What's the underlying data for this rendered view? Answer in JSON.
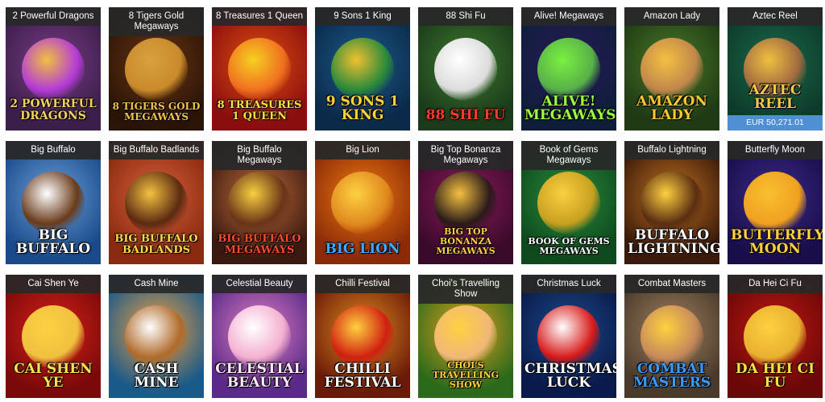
{
  "games": [
    {
      "title": "2 Powerful Dragons",
      "logo": "2 POWERFUL DRAGONS",
      "bg": "#3b1f4a",
      "bg2": "#7a3b86",
      "accent": "#f0c040",
      "fig": "#b43ad8",
      "logo_color": "#f4d060"
    },
    {
      "title": "8 Tigers Gold Megaways",
      "logo": "8 TIGERS GOLD MEGAWAYS",
      "bg": "#2a1408",
      "bg2": "#6a3510",
      "accent": "#d8a040",
      "fig": "#c98a2c",
      "logo_color": "#f2c24a"
    },
    {
      "title": "8 Treasures 1 Queen",
      "logo": "8 TREASURES 1 QUEEN",
      "bg": "#8a0e0e",
      "bg2": "#e05010",
      "accent": "#f6d020",
      "fig": "#f07020",
      "logo_color": "#ffe040"
    },
    {
      "title": "9 Sons 1 King",
      "logo": "9 SONS 1 KING",
      "bg": "#0b2a4a",
      "bg2": "#1c5a8a",
      "accent": "#f0c030",
      "fig": "#2a8a3a",
      "logo_color": "#ffd23a"
    },
    {
      "title": "88 Shi Fu",
      "logo": "88 SHI FU",
      "bg": "#1a3a1a",
      "bg2": "#3e7a2e",
      "accent": "#ffffff",
      "fig": "#dcdcdc",
      "logo_color": "#ff3a2a"
    },
    {
      "title": "Alive! Megaways",
      "logo": "ALIVE! MEGAWAYS",
      "bg": "#0e1e3a",
      "bg2": "#2a1a5a",
      "accent": "#7af040",
      "fig": "#58b048",
      "logo_color": "#9cff40"
    },
    {
      "title": "Amazon Lady",
      "logo": "AMAZON LADY",
      "bg": "#1f3a14",
      "bg2": "#4a7a28",
      "accent": "#f4c040",
      "fig": "#c0864c",
      "logo_color": "#f8c830"
    },
    {
      "title": "Aztec Reel",
      "logo": "AZTEC REEL",
      "bg": "#0d3a2a",
      "bg2": "#1a6a4a",
      "accent": "#f0c040",
      "fig": "#a06a40",
      "logo_color": "#f4c84a",
      "jackpot": "EUR 50,271.01"
    },
    {
      "title": "Big Buffalo",
      "logo": "BIG BUFFALO",
      "bg": "#1a4a8a",
      "bg2": "#6aa0d8",
      "accent": "#ffffff",
      "fig": "#6a3a1a",
      "logo_color": "#ffffff"
    },
    {
      "title": "Big Buffalo Badlands",
      "logo": "BIG BUFFALO BADLANDS",
      "bg": "#8a2a10",
      "bg2": "#d8603a",
      "accent": "#f4c040",
      "fig": "#5a2a12",
      "logo_color": "#ffd84a"
    },
    {
      "title": "Big Buffalo Megaways",
      "logo": "BIG BUFFALO MEGAWAYS",
      "bg": "#3a1a10",
      "bg2": "#c06a3a",
      "accent": "#f8d040",
      "fig": "#6a3418",
      "logo_color": "#ff4a2a"
    },
    {
      "title": "Big Lion",
      "logo": "BIG LION",
      "bg": "#8a2a08",
      "bg2": "#f07a10",
      "accent": "#ffd040",
      "fig": "#e08a20",
      "logo_color": "#40a8ff"
    },
    {
      "title": "Big Top Bonanza Megaways",
      "logo": "BIG TOP BONANZA MEGAWAYS",
      "bg": "#3a0a2a",
      "bg2": "#8a1a5a",
      "accent": "#f4c040",
      "fig": "#2a1a1a",
      "logo_color": "#ffd040"
    },
    {
      "title": "Book of Gems Megaways",
      "logo": "BOOK OF GEMS MEGAWAYS",
      "bg": "#0e4a1e",
      "bg2": "#2a8a3a",
      "accent": "#f8d040",
      "fig": "#c8a020",
      "logo_color": "#ffffff"
    },
    {
      "title": "Buffalo Lightning",
      "logo": "BUFFALO LIGHTNING",
      "bg": "#3a1a0a",
      "bg2": "#c07020",
      "accent": "#ffd040",
      "fig": "#5a2e12",
      "logo_color": "#ffffff"
    },
    {
      "title": "Butterfly Moon",
      "logo": "BUTTERFLY MOON",
      "bg": "#1a0e4a",
      "bg2": "#3a2a8a",
      "accent": "#f8c030",
      "fig": "#f0a020",
      "logo_color": "#ffd040"
    },
    {
      "title": "Cai Shen Ye",
      "logo": "CAI SHEN YE",
      "bg": "#7a0a0a",
      "bg2": "#d82018",
      "accent": "#ffd040",
      "fig": "#f0c040",
      "logo_color": "#ffe050"
    },
    {
      "title": "Cash Mine",
      "logo": "CASH MINE",
      "bg": "#1a5a8a",
      "bg2": "#f0a040",
      "accent": "#ffffff",
      "fig": "#b06a2a",
      "logo_color": "#ffffff"
    },
    {
      "title": "Celestial Beauty",
      "logo": "CELESTIAL BEAUTY",
      "bg": "#5a2a8a",
      "bg2": "#e080c0",
      "accent": "#ffffff",
      "fig": "#f4b0d0",
      "logo_color": "#ffe8ff"
    },
    {
      "title": "Chilli Festival",
      "logo": "CHILLI FESTIVAL",
      "bg": "#6a1a08",
      "bg2": "#e08a20",
      "accent": "#ffd040",
      "fig": "#d02010",
      "logo_color": "#ffffff"
    },
    {
      "title": "Choi's Travelling Show",
      "logo": "CHOI'S TRAVELLING SHOW",
      "bg": "#2a6a1a",
      "bg2": "#e0a020",
      "accent": "#ffd040",
      "fig": "#f0b878",
      "logo_color": "#ffd040"
    },
    {
      "title": "Christmas Luck",
      "logo": "CHRISTMAS LUCK",
      "bg": "#0a1a4a",
      "bg2": "#1a4a8a",
      "accent": "#ffffff",
      "fig": "#d81a1a",
      "logo_color": "#ffffff"
    },
    {
      "title": "Combat Masters",
      "logo": "COMBAT MASTERS",
      "bg": "#4a3a2a",
      "bg2": "#a08060",
      "accent": "#ffd040",
      "fig": "#c88a5a",
      "logo_color": "#3a9aff"
    },
    {
      "title": "Da Hei Ci Fu",
      "logo": "DA HEI CI FU",
      "bg": "#6a0808",
      "bg2": "#c01810",
      "accent": "#ffd040",
      "fig": "#e8b030",
      "logo_color": "#ffe040"
    }
  ]
}
